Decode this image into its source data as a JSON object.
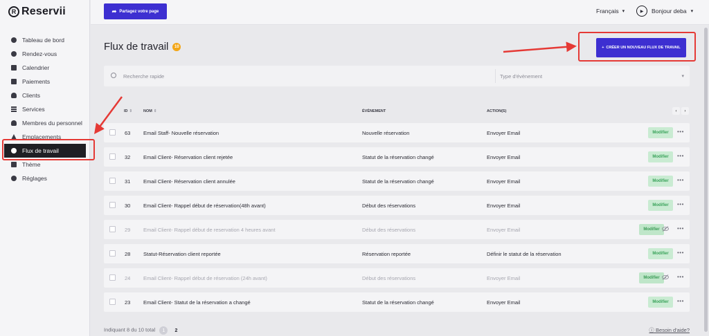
{
  "app": {
    "logo_mark": "R",
    "name": "Reservii"
  },
  "sidebar": {
    "items": [
      {
        "label": "Tableau de bord",
        "icon": "dashboard-icon"
      },
      {
        "label": "Rendez-vous",
        "icon": "clock-icon"
      },
      {
        "label": "Calendrier",
        "icon": "calendar-icon"
      },
      {
        "label": "Paiements",
        "icon": "wallet-icon"
      },
      {
        "label": "Clients",
        "icon": "users-icon"
      },
      {
        "label": "Services",
        "icon": "list-icon"
      },
      {
        "label": "Membres du personnel",
        "icon": "user-icon"
      },
      {
        "label": "Emplacements",
        "icon": "location-icon"
      },
      {
        "label": "Flux de travail",
        "icon": "workflow-icon",
        "active": true
      },
      {
        "label": "Thème",
        "icon": "brush-icon"
      },
      {
        "label": "Réglages",
        "icon": "gear-icon"
      }
    ]
  },
  "topbar": {
    "share_label": "Partagez votre page",
    "language": "Français",
    "greeting": "Bonjour deba"
  },
  "page": {
    "title": "Flux de travail",
    "count": "10",
    "create_label": "CRÉER UN NOUVEAU FLUX DE TRAVAIL",
    "create_plus": "+"
  },
  "filters": {
    "search_placeholder": "Recherche rapide",
    "type_placeholder": "Type d'évènement"
  },
  "table": {
    "headers": {
      "id": "ID",
      "name": "NOM",
      "event": "ÉVÈNEMENT",
      "actions": "ACTION(S)"
    },
    "modify_label": "Modifier",
    "rows": [
      {
        "id": "63",
        "name": "Email Staff- Nouvelle réservation",
        "event": "Nouvelle réservation",
        "action": "Envoyer Email",
        "disabled": false
      },
      {
        "id": "32",
        "name": "Email Client- Réservation client rejetée",
        "event": "Statut de la réservation changé",
        "action": "Envoyer Email",
        "disabled": false
      },
      {
        "id": "31",
        "name": "Email Client- Réservation client annulée",
        "event": "Statut de la réservation changé",
        "action": "Envoyer Email",
        "disabled": false
      },
      {
        "id": "30",
        "name": "Email Client- Rappel début de réservation(48h avant)",
        "event": "Début des réservations",
        "action": "Envoyer Email",
        "disabled": false
      },
      {
        "id": "29",
        "name": "Email Client- Rappel début de reservation 4 heures avant",
        "event": "Début des réservations",
        "action": "Envoyer Email",
        "disabled": true
      },
      {
        "id": "28",
        "name": "Statut-Réservation client reportée",
        "event": "Réservation reportée",
        "action": "Définir le statut de la réservation",
        "disabled": false
      },
      {
        "id": "24",
        "name": "Email Client- Rappel début de réservation (24h avant)",
        "event": "Début des réservations",
        "action": "Envoyer Email",
        "disabled": true
      },
      {
        "id": "23",
        "name": "Email Client- Statut de la réservation a changé",
        "event": "Statut de la réservation changé",
        "action": "Envoyer Email",
        "disabled": false
      }
    ]
  },
  "footer": {
    "showing": "Indiquant 8 du 10 total",
    "pages": [
      "1",
      "2"
    ],
    "help": "Besoin d'aide?"
  },
  "colors": {
    "accent": "#3d2fd1",
    "badge": "#f3a617",
    "annotation": "#e53935",
    "modify_bg": "#c9ebd2",
    "modify_text": "#3aa25a"
  }
}
